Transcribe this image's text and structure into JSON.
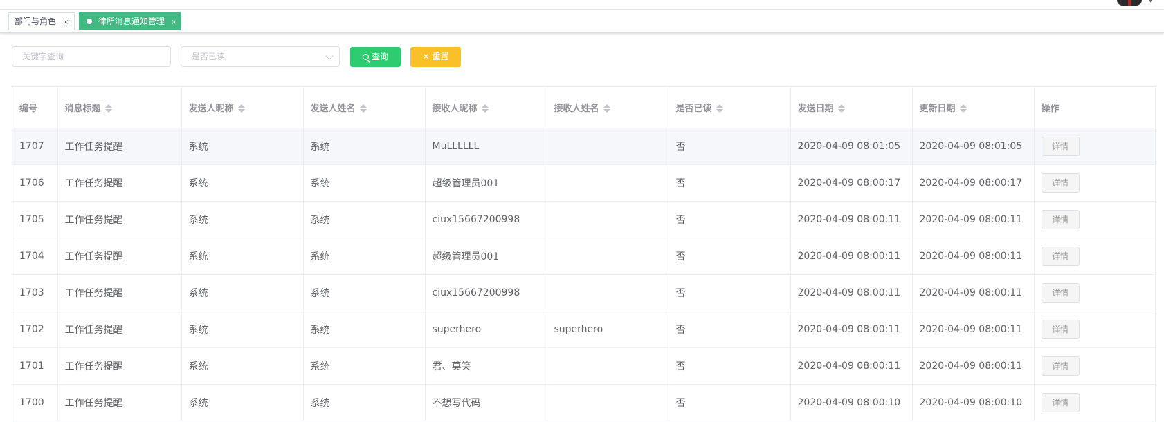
{
  "tags": [
    {
      "label": "部门与角色",
      "close": "×"
    },
    {
      "label": "律所消息通知管理",
      "close": "×"
    }
  ],
  "filters": {
    "keyword_placeholder": "关键字查询",
    "read_placeholder": "是否已读",
    "search_label": "查询",
    "reset_label": "重置"
  },
  "colors": {
    "active_tag": "#42b983",
    "search_button": "#2ecc71",
    "reset_button": "#f9c028"
  },
  "table": {
    "columns": [
      "编号",
      "消息标题",
      "发送人昵称",
      "发送人姓名",
      "接收人昵称",
      "接收人姓名",
      "是否已读",
      "发送日期",
      "更新日期",
      "操作"
    ],
    "rows": [
      {
        "id": "1707",
        "title": "工作任务提醒",
        "sender_nick": "系统",
        "sender_name": "系统",
        "receiver_nick": "MuLLLLLL",
        "receiver_name": "",
        "read": "否",
        "send_date": "2020-04-09 08:01:05",
        "update_date": "2020-04-09 08:01:05",
        "action": "详情"
      },
      {
        "id": "1706",
        "title": "工作任务提醒",
        "sender_nick": "系统",
        "sender_name": "系统",
        "receiver_nick": "超级管理员001",
        "receiver_name": "",
        "read": "否",
        "send_date": "2020-04-09 08:00:17",
        "update_date": "2020-04-09 08:00:17",
        "action": "详情"
      },
      {
        "id": "1705",
        "title": "工作任务提醒",
        "sender_nick": "系统",
        "sender_name": "系统",
        "receiver_nick": "ciux15667200998",
        "receiver_name": "",
        "read": "否",
        "send_date": "2020-04-09 08:00:11",
        "update_date": "2020-04-09 08:00:11",
        "action": "详情"
      },
      {
        "id": "1704",
        "title": "工作任务提醒",
        "sender_nick": "系统",
        "sender_name": "系统",
        "receiver_nick": "超级管理员001",
        "receiver_name": "",
        "read": "否",
        "send_date": "2020-04-09 08:00:11",
        "update_date": "2020-04-09 08:00:11",
        "action": "详情"
      },
      {
        "id": "1703",
        "title": "工作任务提醒",
        "sender_nick": "系统",
        "sender_name": "系统",
        "receiver_nick": "ciux15667200998",
        "receiver_name": "",
        "read": "否",
        "send_date": "2020-04-09 08:00:11",
        "update_date": "2020-04-09 08:00:11",
        "action": "详情"
      },
      {
        "id": "1702",
        "title": "工作任务提醒",
        "sender_nick": "系统",
        "sender_name": "系统",
        "receiver_nick": "superhero",
        "receiver_name": "superhero",
        "read": "否",
        "send_date": "2020-04-09 08:00:11",
        "update_date": "2020-04-09 08:00:11",
        "action": "详情"
      },
      {
        "id": "1701",
        "title": "工作任务提醒",
        "sender_nick": "系统",
        "sender_name": "系统",
        "receiver_nick": "君、莫笑",
        "receiver_name": "",
        "read": "否",
        "send_date": "2020-04-09 08:00:11",
        "update_date": "2020-04-09 08:00:11",
        "action": "详情"
      },
      {
        "id": "1700",
        "title": "工作任务提醒",
        "sender_nick": "系统",
        "sender_name": "系统",
        "receiver_nick": "不想写代码",
        "receiver_name": "",
        "read": "否",
        "send_date": "2020-04-09 08:00:10",
        "update_date": "2020-04-09 08:00:10",
        "action": "详情"
      }
    ]
  }
}
